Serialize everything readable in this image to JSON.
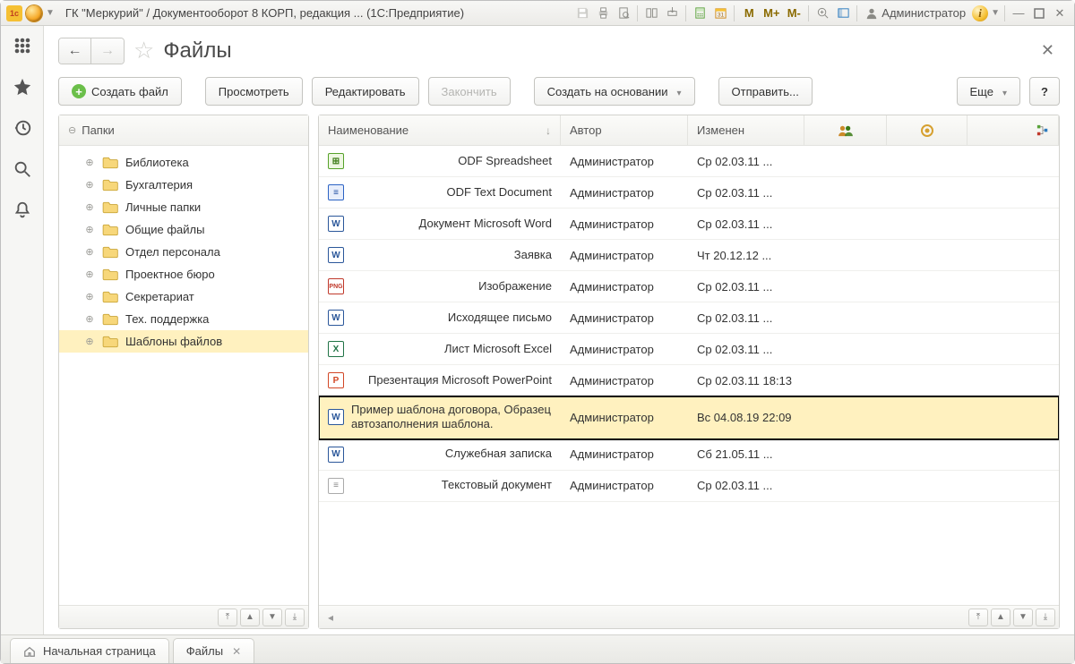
{
  "titlebar": {
    "title": "ГК \"Меркурий\" / Документооборот 8 КОРП, редакция ...  (1С:Предприятие)",
    "user": "Администратор",
    "m_buttons": [
      "M",
      "M+",
      "M-"
    ]
  },
  "page": {
    "title": "Файлы"
  },
  "toolbar": {
    "create": "Создать файл",
    "view": "Просмотреть",
    "edit": "Редактировать",
    "finish": "Закончить",
    "create_based": "Создать на основании",
    "send": "Отправить...",
    "more": "Еще",
    "help": "?"
  },
  "tree": {
    "root": "Папки",
    "items": [
      "Библиотека",
      "Бухгалтерия",
      "Личные папки",
      "Общие файлы",
      "Отдел персонала",
      "Проектное бюро",
      "Секретариат",
      "Тех. поддержка",
      "Шаблоны файлов"
    ],
    "selected_index": 8
  },
  "table": {
    "columns": {
      "name": "Наименование",
      "author": "Автор",
      "modified": "Изменен"
    },
    "rows": [
      {
        "icon": "ods",
        "name": "ODF Spreadsheet",
        "author": "Администратор",
        "modified": "Ср 02.03.11 ..."
      },
      {
        "icon": "odt",
        "name": "ODF Text Document",
        "author": "Администратор",
        "modified": "Ср 02.03.11 ..."
      },
      {
        "icon": "doc",
        "name": "Документ Microsoft Word",
        "author": "Администратор",
        "modified": "Ср 02.03.11 ..."
      },
      {
        "icon": "doc",
        "name": "Заявка",
        "author": "Администратор",
        "modified": "Чт 20.12.12 ..."
      },
      {
        "icon": "png",
        "name": "Изображение",
        "author": "Администратор",
        "modified": "Ср 02.03.11 ..."
      },
      {
        "icon": "doc",
        "name": "Исходящее письмо",
        "author": "Администратор",
        "modified": "Ср 02.03.11 ..."
      },
      {
        "icon": "xls",
        "name": "Лист Microsoft Excel",
        "author": "Администратор",
        "modified": "Ср 02.03.11 ..."
      },
      {
        "icon": "ppt",
        "name": "Презентация Microsoft PowerPoint",
        "author": "Администратор",
        "modified": "Ср 02.03.11 18:13"
      },
      {
        "icon": "doc",
        "name": "Пример шаблона договора, Образец автозаполнения шаблона.",
        "author": "Администратор",
        "modified": "Вс 04.08.19 22:09"
      },
      {
        "icon": "doc",
        "name": "Служебная записка",
        "author": "Администратор",
        "modified": "Сб 21.05.11 ..."
      },
      {
        "icon": "txt",
        "name": "Текстовый документ",
        "author": "Администратор",
        "modified": "Ср 02.03.11 ..."
      }
    ],
    "selected_index": 8
  },
  "bottom_tabs": {
    "home": "Начальная страница",
    "current": "Файлы"
  }
}
